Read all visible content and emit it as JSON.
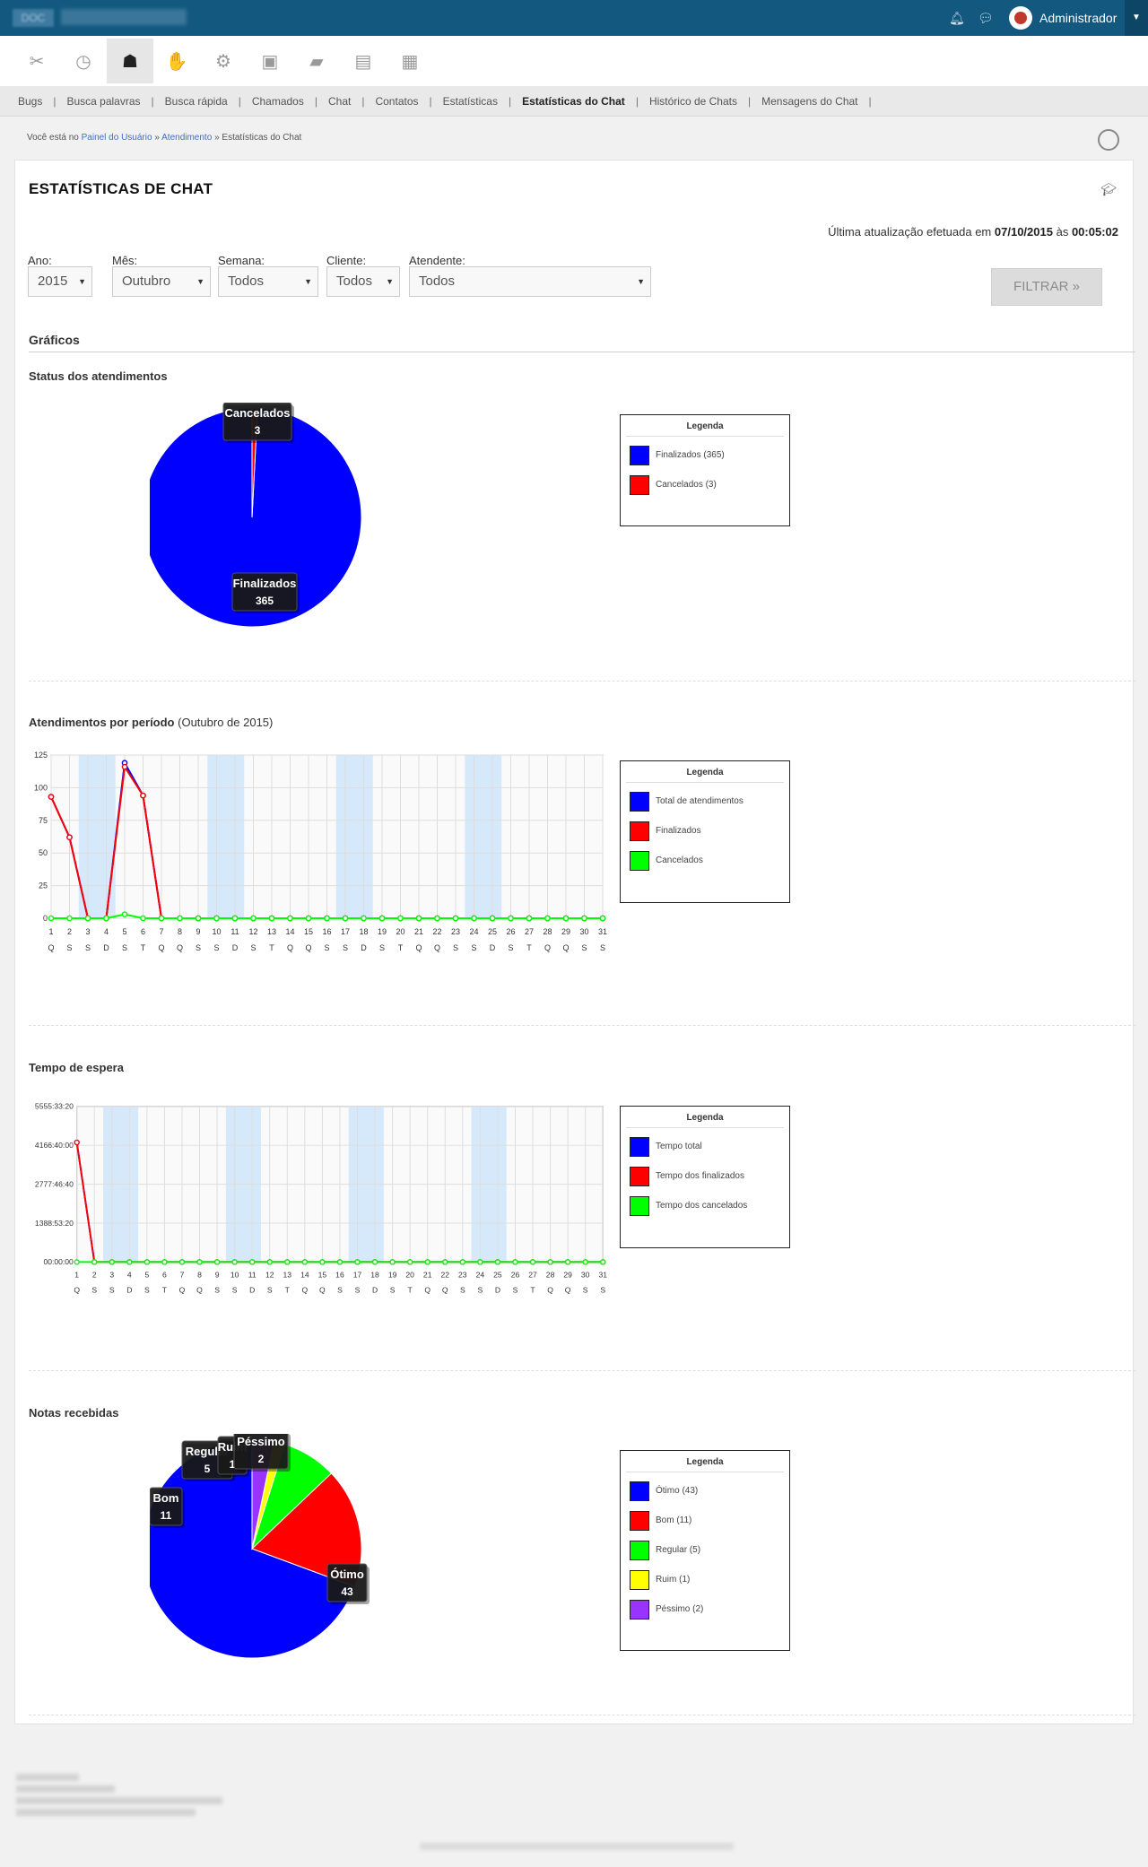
{
  "header": {
    "logo_text": "DOC",
    "user_name": "Administrador"
  },
  "tabs": [
    {
      "label": "Bugs",
      "active": false
    },
    {
      "label": "Busca palavras",
      "active": false
    },
    {
      "label": "Busca rápida",
      "active": false
    },
    {
      "label": "Chamados",
      "active": false
    },
    {
      "label": "Chat",
      "active": false
    },
    {
      "label": "Contatos",
      "active": false
    },
    {
      "label": "Estatísticas",
      "active": false
    },
    {
      "label": "Estatísticas do Chat",
      "active": true
    },
    {
      "label": "Histórico de Chats",
      "active": false
    },
    {
      "label": "Mensagens do Chat",
      "active": false
    }
  ],
  "breadcrumb": {
    "prefix": "Você está no",
    "crumb1": "Painel do Usuário",
    "sep": "»",
    "crumb2": "Atendimento",
    "current": "Estatísticas do Chat"
  },
  "page": {
    "title": "ESTATÍSTICAS DE CHAT",
    "last_update_prefix": "Última atualização efetuada em",
    "last_update_date": "07/10/2015",
    "last_update_mid": "às",
    "last_update_time": "00:05:02"
  },
  "filters": {
    "ano_label": "Ano:",
    "ano_value": "2015",
    "mes_label": "Mês:",
    "mes_value": "Outubro",
    "semana_label": "Semana:",
    "semana_value": "Todos",
    "cliente_label": "Cliente:",
    "cliente_value": "Todos",
    "atendente_label": "Atendente:",
    "atendente_value": "Todos",
    "submit_label": "FILTRAR »"
  },
  "sections": {
    "graficos": "Gráficos",
    "status_title": "Status dos atendimentos",
    "periodo_title": "Atendimentos por período",
    "periodo_sub": "(Outubro de 2015)",
    "espera_title": "Tempo de espera",
    "notas_title": "Notas recebidas"
  },
  "legend_title": "Legenda",
  "legends": {
    "status": [
      {
        "label": "Finalizados (365)",
        "color": "#0000ff"
      },
      {
        "label": "Cancelados (3)",
        "color": "#ff0000"
      }
    ],
    "periodo": [
      {
        "label": "Total de atendimentos",
        "color": "#0000ff"
      },
      {
        "label": "Finalizados",
        "color": "#ff0000"
      },
      {
        "label": "Cancelados",
        "color": "#00ff00"
      }
    ],
    "espera": [
      {
        "label": "Tempo total",
        "color": "#0000ff"
      },
      {
        "label": "Tempo dos finalizados",
        "color": "#ff0000"
      },
      {
        "label": "Tempo dos cancelados",
        "color": "#00ff00"
      }
    ],
    "notas": [
      {
        "label": "Ótimo (43)",
        "color": "#0000ff"
      },
      {
        "label": "Bom (11)",
        "color": "#ff0000"
      },
      {
        "label": "Regular (5)",
        "color": "#00ff00"
      },
      {
        "label": "Ruim (1)",
        "color": "#ffff00"
      },
      {
        "label": "Péssimo (2)",
        "color": "#9933ff"
      }
    ]
  },
  "chart_data": [
    {
      "type": "pie",
      "title": "Status dos atendimentos",
      "slices": [
        {
          "label": "Finalizados",
          "value": 365,
          "color": "#0000ff"
        },
        {
          "label": "Cancelados",
          "value": 3,
          "color": "#ff0000"
        }
      ]
    },
    {
      "type": "line",
      "title": "Atendimentos por período (Outubro de 2015)",
      "x": [
        1,
        2,
        3,
        4,
        5,
        6,
        7,
        8,
        9,
        10,
        11,
        12,
        13,
        14,
        15,
        16,
        17,
        18,
        19,
        20,
        21,
        22,
        23,
        24,
        25,
        26,
        27,
        28,
        29,
        30,
        31
      ],
      "x_weekday": [
        "Q",
        "S",
        "S",
        "D",
        "S",
        "T",
        "Q",
        "Q",
        "S",
        "S",
        "D",
        "S",
        "T",
        "Q",
        "Q",
        "S",
        "S",
        "D",
        "S",
        "T",
        "Q",
        "Q",
        "S",
        "S",
        "D",
        "S",
        "T",
        "Q",
        "Q",
        "S",
        "S"
      ],
      "y_ticks": [
        0,
        25,
        50,
        75,
        100,
        125
      ],
      "ylim": [
        0,
        125
      ],
      "series": [
        {
          "name": "Total de atendimentos",
          "color": "#0000ff",
          "values": [
            93,
            62,
            0,
            0,
            119,
            94,
            0,
            0,
            0,
            0,
            0,
            0,
            0,
            0,
            0,
            0,
            0,
            0,
            0,
            0,
            0,
            0,
            0,
            0,
            0,
            0,
            0,
            0,
            0,
            0,
            0
          ]
        },
        {
          "name": "Finalizados",
          "color": "#ff0000",
          "values": [
            93,
            62,
            0,
            0,
            116,
            94,
            0,
            0,
            0,
            0,
            0,
            0,
            0,
            0,
            0,
            0,
            0,
            0,
            0,
            0,
            0,
            0,
            0,
            0,
            0,
            0,
            0,
            0,
            0,
            0,
            0
          ]
        },
        {
          "name": "Cancelados",
          "color": "#00ff00",
          "values": [
            0,
            0,
            0,
            0,
            3,
            0,
            0,
            0,
            0,
            0,
            0,
            0,
            0,
            0,
            0,
            0,
            0,
            0,
            0,
            0,
            0,
            0,
            0,
            0,
            0,
            0,
            0,
            0,
            0,
            0,
            0
          ]
        }
      ]
    },
    {
      "type": "line",
      "title": "Tempo de espera",
      "x": [
        1,
        2,
        3,
        4,
        5,
        6,
        7,
        8,
        9,
        10,
        11,
        12,
        13,
        14,
        15,
        16,
        17,
        18,
        19,
        20,
        21,
        22,
        23,
        24,
        25,
        26,
        27,
        28,
        29,
        30,
        31
      ],
      "x_weekday": [
        "Q",
        "S",
        "S",
        "D",
        "S",
        "T",
        "Q",
        "Q",
        "S",
        "S",
        "D",
        "S",
        "T",
        "Q",
        "Q",
        "S",
        "S",
        "D",
        "S",
        "T",
        "Q",
        "Q",
        "S",
        "S",
        "D",
        "S",
        "T",
        "Q",
        "Q",
        "S",
        "S"
      ],
      "y_ticks": [
        "00:00:00",
        "1388:53:20",
        "2777:46:40",
        "4166:40:00",
        "5555:33:20"
      ],
      "ylim_hours": [
        0,
        5555.5556
      ],
      "series": [
        {
          "name": "Tempo total",
          "color": "#0000ff",
          "values_hours": [
            4270,
            0,
            0,
            0,
            0,
            0,
            0,
            0,
            0,
            0,
            0,
            0,
            0,
            0,
            0,
            0,
            0,
            0,
            0,
            0,
            0,
            0,
            0,
            0,
            0,
            0,
            0,
            0,
            0,
            0,
            0
          ]
        },
        {
          "name": "Tempo dos finalizados",
          "color": "#ff0000",
          "values_hours": [
            4270,
            0,
            0,
            0,
            0,
            0,
            0,
            0,
            0,
            0,
            0,
            0,
            0,
            0,
            0,
            0,
            0,
            0,
            0,
            0,
            0,
            0,
            0,
            0,
            0,
            0,
            0,
            0,
            0,
            0,
            0
          ]
        },
        {
          "name": "Tempo dos cancelados",
          "color": "#00ff00",
          "values_hours": [
            0,
            0,
            0,
            0,
            0,
            0,
            0,
            0,
            0,
            0,
            0,
            0,
            0,
            0,
            0,
            0,
            0,
            0,
            0,
            0,
            0,
            0,
            0,
            0,
            0,
            0,
            0,
            0,
            0,
            0,
            0
          ]
        }
      ]
    },
    {
      "type": "pie",
      "title": "Notas recebidas",
      "slices": [
        {
          "label": "Ótimo",
          "value": 43,
          "color": "#0000ff"
        },
        {
          "label": "Bom",
          "value": 11,
          "color": "#ff0000"
        },
        {
          "label": "Regular",
          "value": 5,
          "color": "#00ff00"
        },
        {
          "label": "Ruim",
          "value": 1,
          "color": "#ffff00"
        },
        {
          "label": "Péssimo",
          "value": 2,
          "color": "#9933ff"
        }
      ]
    }
  ]
}
